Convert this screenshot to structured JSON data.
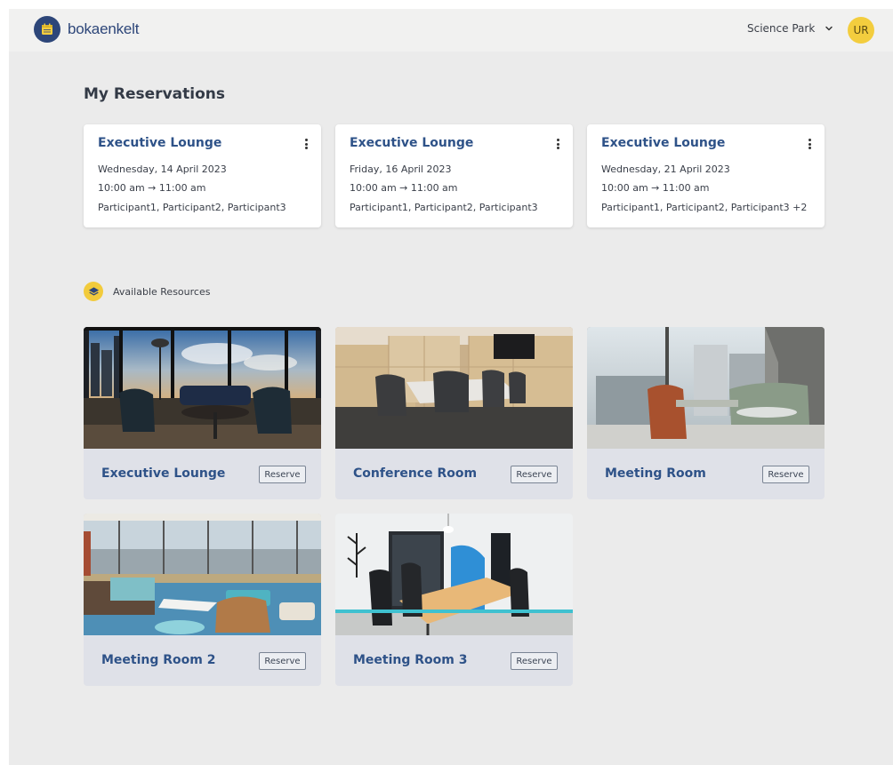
{
  "header": {
    "brand": "bokaenkelt",
    "location": "Science Park",
    "user_initials": "UR"
  },
  "reservations": {
    "title": "My Reservations",
    "items": [
      {
        "room": "Executive Lounge",
        "date": "Wednesday, 14 April 2023",
        "time": "10:00 am → 11:00 am",
        "participants": "Participant1, Participant2, Participant3"
      },
      {
        "room": "Executive Lounge",
        "date": "Friday, 16 April 2023",
        "time": "10:00 am → 11:00 am",
        "participants": "Participant1, Participant2, Participant3"
      },
      {
        "room": "Executive Lounge",
        "date": "Wednesday, 21 April 2023",
        "time": "10:00 am → 11:00 am",
        "participants": "Participant1, Participant2, Participant3 +2"
      }
    ]
  },
  "resources": {
    "title": "Available Resources",
    "reserve_label": "Reserve",
    "items": [
      {
        "name": "Executive Lounge"
      },
      {
        "name": "Conference Room"
      },
      {
        "name": "Meeting Room"
      },
      {
        "name": "Meeting Room 2"
      },
      {
        "name": "Meeting Room 3"
      }
    ]
  },
  "colors": {
    "brand": "#2d4679",
    "accent_yellow": "#f3cd3e",
    "title_blue": "#2e5288",
    "card_bg": "#dfe1e8"
  }
}
